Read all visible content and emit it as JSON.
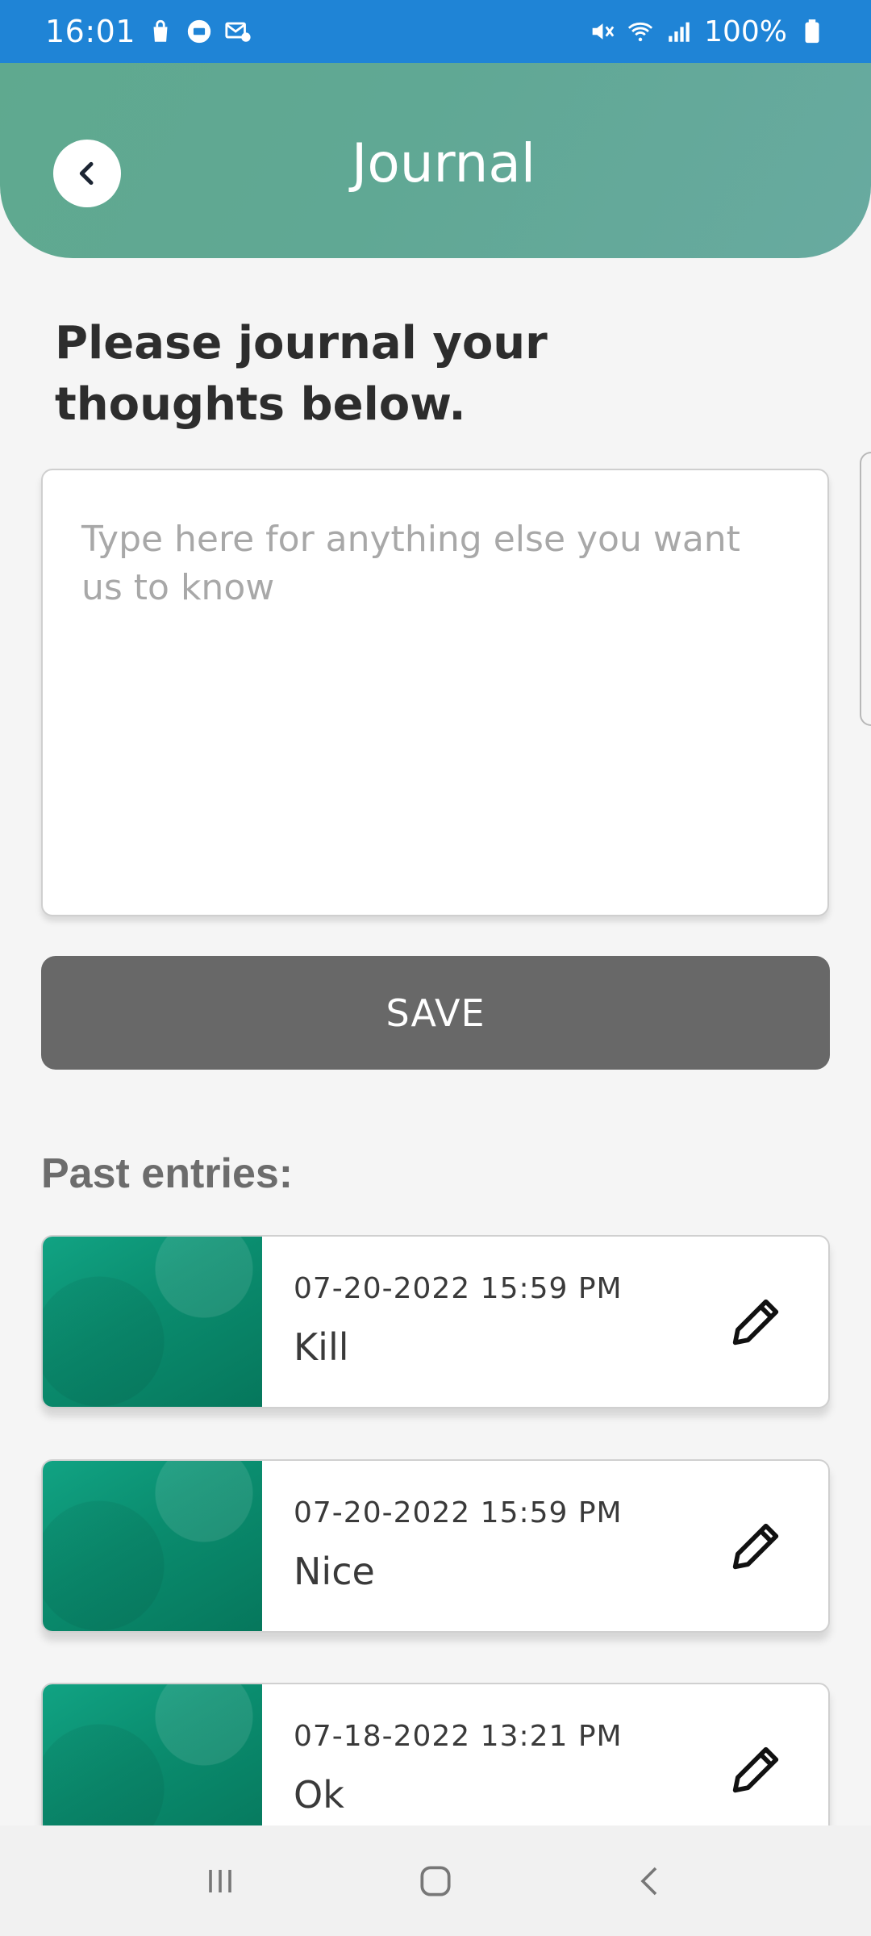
{
  "status_bar": {
    "time": "16:01",
    "battery": "100%"
  },
  "header": {
    "title": "Journal"
  },
  "prompt": "Please journal your thoughts below.",
  "journal": {
    "placeholder": "Type here for anything else you want us to know",
    "value": ""
  },
  "save_label": "SAVE",
  "past_entries_label": "Past entries:",
  "entries": [
    {
      "date": "07-20-2022  15:59 PM",
      "text": "Kill"
    },
    {
      "date": "07-20-2022  15:59 PM",
      "text": "Nice"
    },
    {
      "date": "07-18-2022  13:21 PM",
      "text": "Ok"
    }
  ],
  "colors": {
    "status_bar": "#1f84d6",
    "header": "#5fa98f",
    "save_button": "#686868",
    "thumb": "#0a8c6e"
  }
}
